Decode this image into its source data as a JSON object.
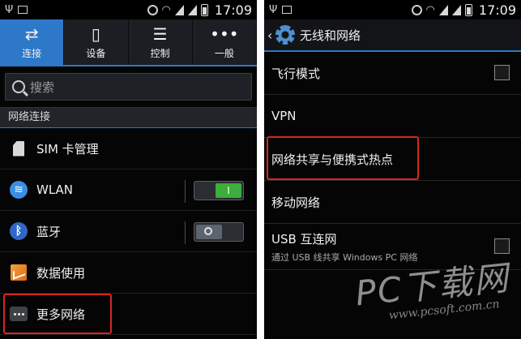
{
  "status_bar": {
    "time": "17:09"
  },
  "left": {
    "tabs": [
      {
        "label": "连接",
        "icon": "swap-arrows-icon",
        "glyph": "⇄"
      },
      {
        "label": "设备",
        "icon": "device-icon",
        "glyph": "▯"
      },
      {
        "label": "控制",
        "icon": "sliders-icon",
        "glyph": "☰"
      },
      {
        "label": "一般",
        "icon": "more-dots-icon",
        "glyph": "•••"
      }
    ],
    "search_placeholder": "搜索",
    "section_header": "网络连接",
    "items": [
      {
        "label": "SIM 卡管理",
        "icon": "sim-card-icon"
      },
      {
        "label": "WLAN",
        "icon": "wifi-icon",
        "toggle": "on",
        "toggle_glyph": "I"
      },
      {
        "label": "蓝牙",
        "icon": "bluetooth-icon",
        "toggle": "off"
      },
      {
        "label": "数据使用",
        "icon": "data-usage-icon"
      },
      {
        "label": "更多网络",
        "icon": "more-networks-icon"
      }
    ]
  },
  "right": {
    "back_glyph": "‹",
    "title": "无线和网络",
    "items": [
      {
        "label": "飞行模式",
        "checkbox": false
      },
      {
        "label": "VPN"
      },
      {
        "label": "网络共享与便携式热点"
      },
      {
        "label": "移动网络"
      },
      {
        "label": "USB 互连网",
        "sublabel": "通过 USB 线共享 Windows PC 网络",
        "checkbox": false
      }
    ]
  },
  "watermark": {
    "main": "PC下载网",
    "url": "www.pcsoft.com.cn"
  },
  "colors": {
    "accent": "#2d78c8",
    "highlight": "#d8261f",
    "toggle_on": "#3cae3c"
  }
}
